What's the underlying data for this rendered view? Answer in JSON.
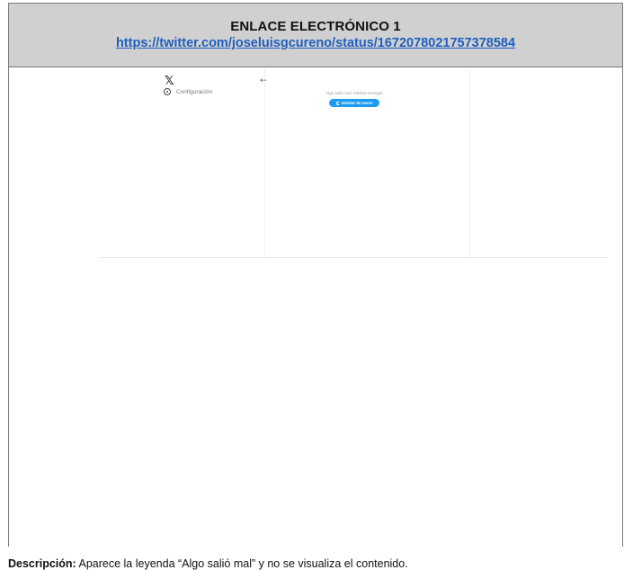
{
  "header": {
    "title": "ENLACE ELECTRÓNICO 1",
    "link": "https://twitter.com/joseluisgcureno/status/1672078021757378584"
  },
  "screenshot": {
    "logo_icon": "x-logo-icon",
    "back_icon": "arrow-left-icon",
    "settings_icon": "gear-icon",
    "settings_label": "Configuración",
    "error_message": "Algo salió mal. Intenta recargar.",
    "retry_label": "Intentar de nuevo",
    "retry_icon": "refresh-icon",
    "accent_color": "#1d9bf0"
  },
  "description": {
    "label": "Descripción:",
    "text": " Aparece la leyenda “Algo salió mal” y no se visualiza el contenido."
  }
}
